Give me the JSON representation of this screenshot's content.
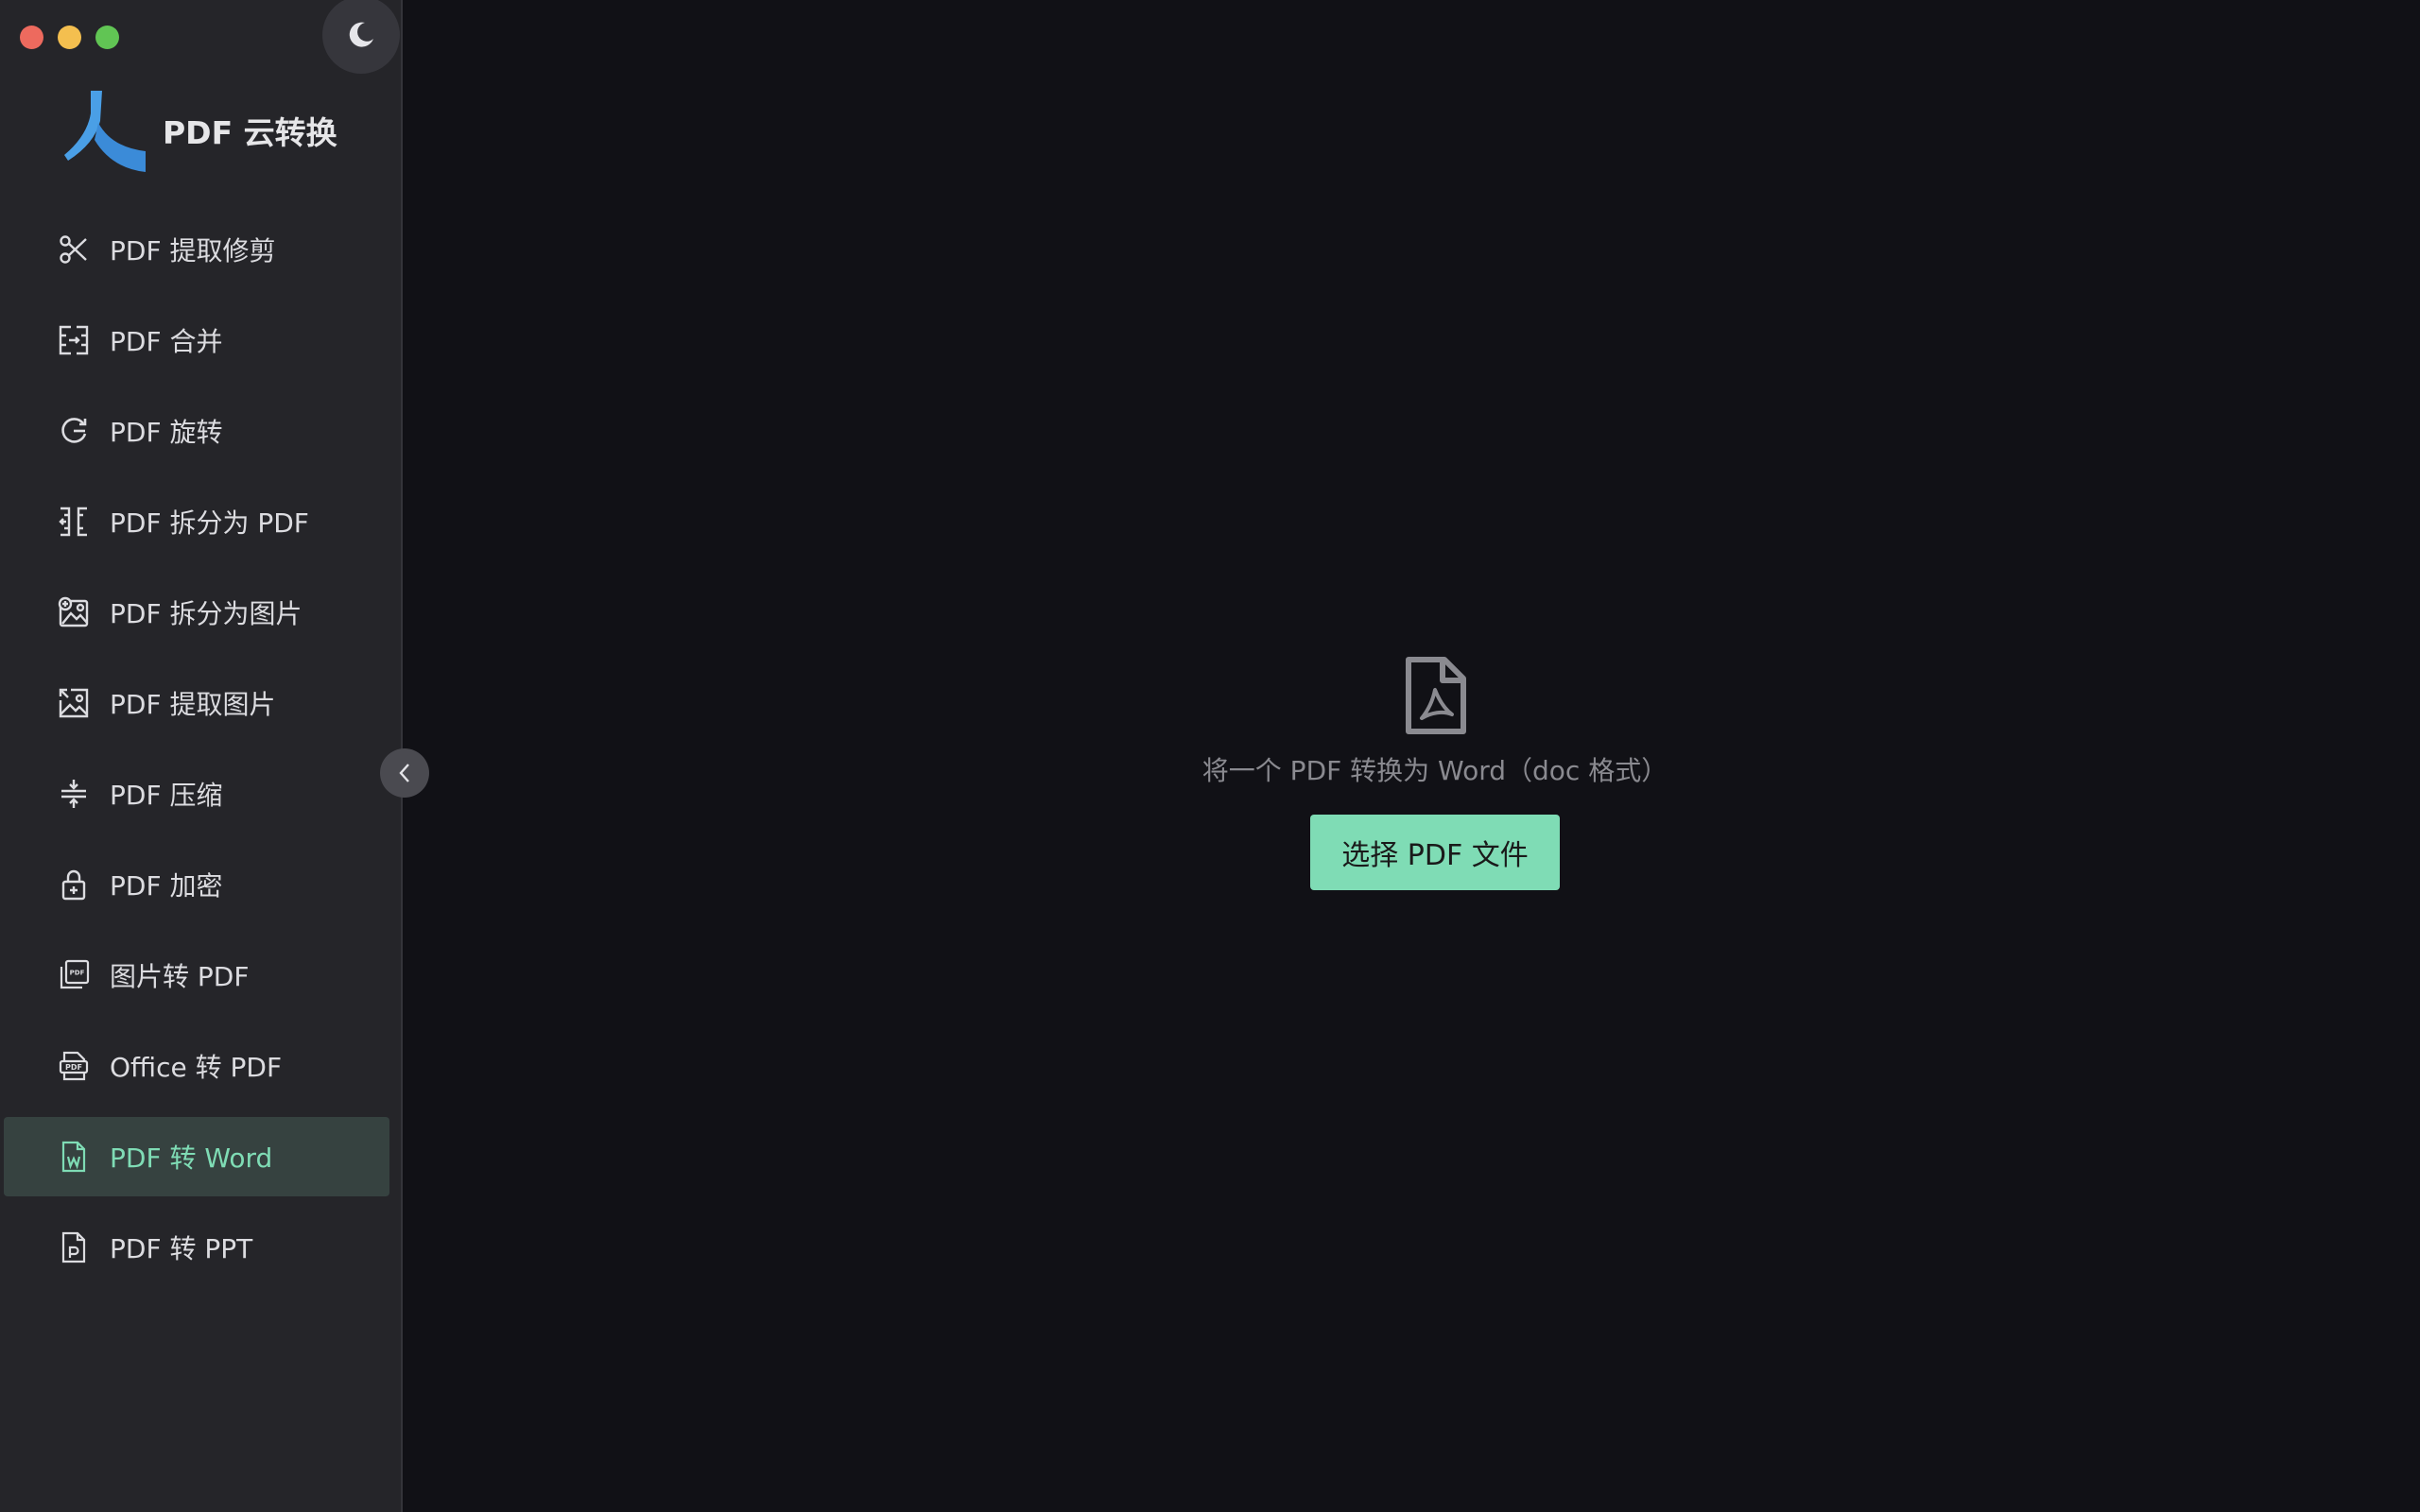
{
  "brand": {
    "name": "PDF 云转换"
  },
  "nav": [
    {
      "label": "PDF 提取修剪",
      "icon": "scissors-icon"
    },
    {
      "label": "PDF 合并",
      "icon": "merge-icon"
    },
    {
      "label": "PDF 旋转",
      "icon": "rotate-icon"
    },
    {
      "label": "PDF 拆分为 PDF",
      "icon": "split-icon"
    },
    {
      "label": "PDF 拆分为图片",
      "icon": "split-image-icon"
    },
    {
      "label": "PDF 提取图片",
      "icon": "extract-image-icon"
    },
    {
      "label": "PDF 压缩",
      "icon": "compress-icon"
    },
    {
      "label": "PDF 加密",
      "icon": "lock-icon"
    },
    {
      "label": "图片转 PDF",
      "icon": "image-to-pdf-icon"
    },
    {
      "label": "Office 转 PDF",
      "icon": "office-to-pdf-icon"
    },
    {
      "label": "PDF 转 Word",
      "icon": "word-file-icon",
      "active": true
    },
    {
      "label": "PDF 转 PPT",
      "icon": "ppt-file-icon"
    }
  ],
  "main": {
    "description": "将一个 PDF 转换为 Word（doc 格式）",
    "select_button": "选择 PDF 文件"
  },
  "colors": {
    "accent": "#7fdcb5",
    "sidebar_bg": "#252529",
    "main_bg": "#111116",
    "active_item_bg": "#364240"
  }
}
